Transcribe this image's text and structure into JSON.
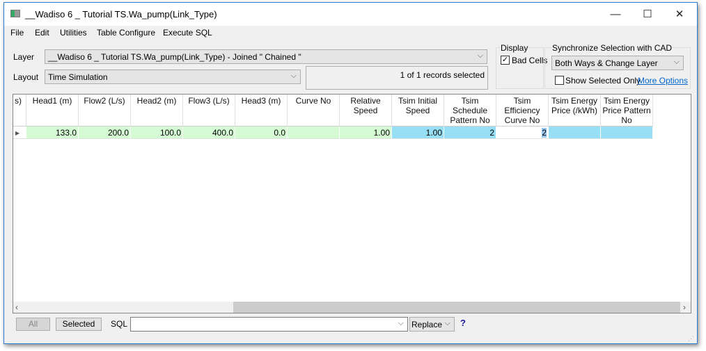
{
  "window": {
    "title": "__Wadiso 6 _ Tutorial TS.Wa_pump(Link_Type)",
    "minimize": "—",
    "maximize": "☐",
    "close": "✕"
  },
  "menu": [
    "File",
    "Edit",
    "Utilities",
    "Table Configure",
    "Execute SQL"
  ],
  "layer": {
    "label": "Layer",
    "value": "__Wadiso 6 _ Tutorial TS.Wa_pump(Link_Type) - Joined \" Chained \""
  },
  "layout": {
    "label": "Layout",
    "value": "Time Simulation"
  },
  "status": "1 of 1 records selected",
  "display": {
    "title": "Display",
    "bad_cells": "Bad Cells",
    "bad_cells_checked": true
  },
  "sync": {
    "title": "Synchronize Selection with CAD",
    "value": "Both Ways & Change Layer",
    "show_selected_only": "Show Selected Only",
    "show_selected_checked": false,
    "more_options": "More Options"
  },
  "table": {
    "partial_header": "s)",
    "columns": [
      "Head1 (m)",
      "Flow2 (L/s)",
      "Head2 (m)",
      "Flow3 (L/s)",
      "Head3 (m)",
      "Curve No",
      "Relative Speed",
      "Tsim Initial Speed",
      "Tsim Schedule Pattern No",
      "Tsim Efficiency Curve No",
      "Tsim Energy Price (/kWh)",
      "Tsim Energy Price Pattern No"
    ],
    "rows": [
      [
        "133.0",
        "200.0",
        "100.0",
        "400.0",
        "0.0",
        "",
        "1.00",
        "1.00",
        "2",
        "2",
        "",
        ""
      ]
    ],
    "cell_colors": {
      "green": "#d5fbd5",
      "blue": "#98dff6"
    }
  },
  "footer": {
    "all": "All",
    "selected": "Selected",
    "sql_label": "SQL",
    "sql_value": "",
    "replace": "Replace",
    "help": "?"
  }
}
